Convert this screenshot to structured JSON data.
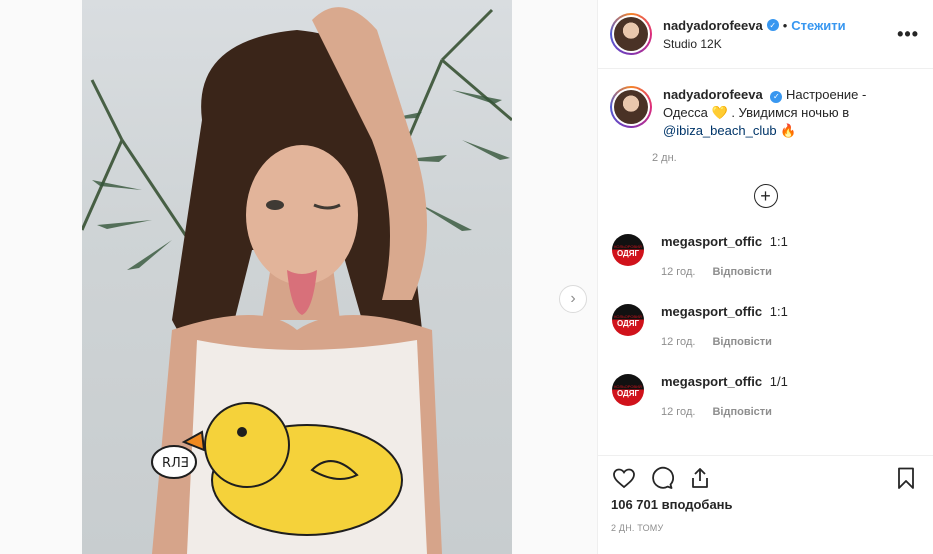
{
  "post": {
    "navigation": {
      "next_icon": "chevron-right-icon"
    }
  },
  "header": {
    "username": "nadyadorofeeva",
    "verified_icon": "verified-badge-icon",
    "separator": "•",
    "follow_label": "Стежити",
    "location": "Studio 12K",
    "more_icon": "more-options-icon"
  },
  "caption": {
    "username": "nadyadorofeeva",
    "text_part1": "Настроение - Одесса",
    "emoji_heart": "💛",
    "text_part2": ". Увидимся ночью в",
    "mention": "@ibiza_beach_club",
    "emoji_fire": "🔥",
    "time": "2 дн."
  },
  "load_more_icon": "plus-circle-icon",
  "comments": [
    {
      "username": "megasport_offic",
      "text": "1:1",
      "time": "12 год.",
      "reply_label": "Відповісти",
      "avatar_top": "КОЛЬОРОВИЙ",
      "avatar_bottom": "ОДЯГ"
    },
    {
      "username": "megasport_offic",
      "text": "1:1",
      "time": "12 год.",
      "reply_label": "Відповісти",
      "avatar_top": "КОЛЬОРОВИЙ",
      "avatar_bottom": "ОДЯГ"
    },
    {
      "username": "megasport_offic",
      "text": "1/1",
      "time": "12 год.",
      "reply_label": "Відповісти",
      "avatar_top": "КОЛЬОРОВИЙ",
      "avatar_bottom": "ОДЯГ"
    }
  ],
  "actions": {
    "like_icon": "heart-icon",
    "comment_icon": "comment-icon",
    "share_icon": "share-icon",
    "save_icon": "bookmark-icon",
    "likes_text": "106 701 вподобань",
    "timestamp": "2 ДН. ТОМУ"
  },
  "colors": {
    "accent": "#3897f0",
    "text": "#262626",
    "muted": "#8e8e8e",
    "mention": "#003569"
  }
}
